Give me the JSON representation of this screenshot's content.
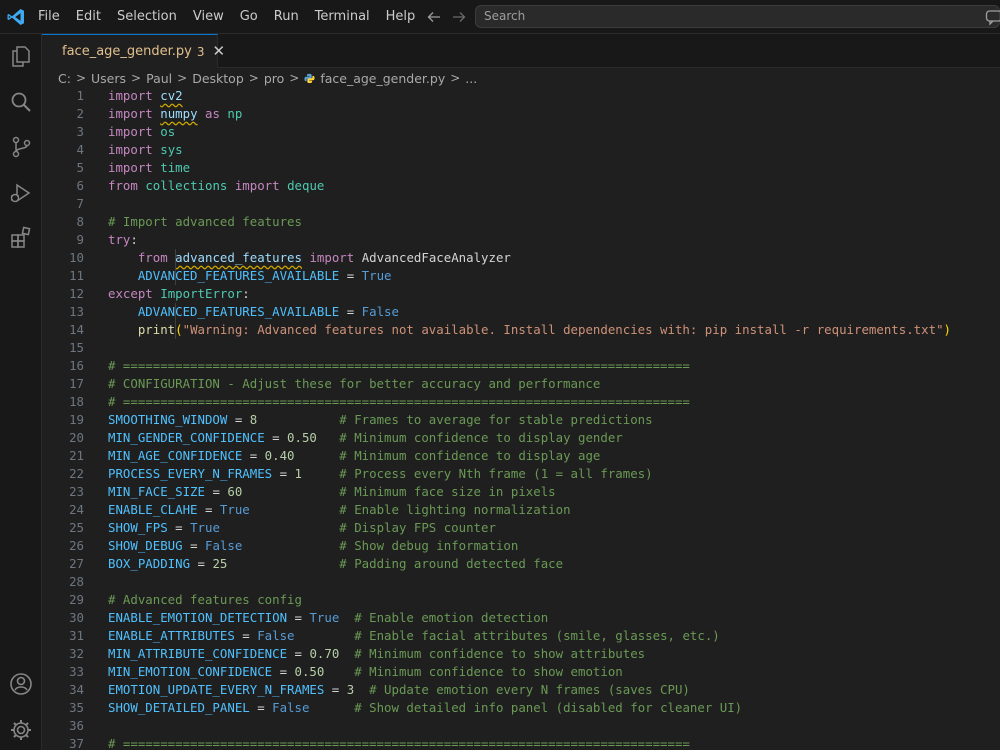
{
  "menu": [
    "File",
    "Edit",
    "Selection",
    "View",
    "Go",
    "Run",
    "Terminal",
    "Help"
  ],
  "search": {
    "placeholder": "Search"
  },
  "tab": {
    "name": "face_age_gender.py",
    "badge": "3",
    "close": "✕"
  },
  "breadcrumb": [
    "C:",
    "Users",
    "Paul",
    "Desktop",
    "pro",
    "face_age_gender.py",
    "..."
  ],
  "activity_icons": [
    "explorer-icon",
    "search-icon",
    "source-control-icon",
    "run-debug-icon",
    "extensions-icon",
    "accounts-icon",
    "settings-gear-icon"
  ],
  "colors": {
    "accent": "#0078d4",
    "editor_bg": "#1f1f1f",
    "sidebar_bg": "#181818",
    "modified_text": "#e2c08d"
  },
  "code": [
    {
      "n": "1",
      "t": [
        {
          "c": "kw",
          "v": "import"
        },
        {
          "c": "plain",
          "v": " "
        },
        {
          "c": "mod2 squig",
          "v": "cv2"
        }
      ]
    },
    {
      "n": "2",
      "t": [
        {
          "c": "kw",
          "v": "import"
        },
        {
          "c": "plain",
          "v": " "
        },
        {
          "c": "mod2 squig",
          "v": "numpy"
        },
        {
          "c": "plain",
          "v": " "
        },
        {
          "c": "kw",
          "v": "as"
        },
        {
          "c": "plain",
          "v": " "
        },
        {
          "c": "mod",
          "v": "np"
        }
      ]
    },
    {
      "n": "3",
      "t": [
        {
          "c": "kw",
          "v": "import"
        },
        {
          "c": "plain",
          "v": " "
        },
        {
          "c": "mod",
          "v": "os"
        }
      ]
    },
    {
      "n": "4",
      "t": [
        {
          "c": "kw",
          "v": "import"
        },
        {
          "c": "plain",
          "v": " "
        },
        {
          "c": "mod",
          "v": "sys"
        }
      ]
    },
    {
      "n": "5",
      "t": [
        {
          "c": "kw",
          "v": "import"
        },
        {
          "c": "plain",
          "v": " "
        },
        {
          "c": "mod",
          "v": "time"
        }
      ]
    },
    {
      "n": "6",
      "t": [
        {
          "c": "kw",
          "v": "from"
        },
        {
          "c": "plain",
          "v": " "
        },
        {
          "c": "mod",
          "v": "collections"
        },
        {
          "c": "plain",
          "v": " "
        },
        {
          "c": "kw",
          "v": "import"
        },
        {
          "c": "plain",
          "v": " "
        },
        {
          "c": "cls",
          "v": "deque"
        }
      ]
    },
    {
      "n": "7",
      "t": []
    },
    {
      "n": "8",
      "t": [
        {
          "c": "cmt",
          "v": "# Import advanced features"
        }
      ]
    },
    {
      "n": "9",
      "t": [
        {
          "c": "kw",
          "v": "try"
        },
        {
          "c": "plain",
          "v": ":"
        }
      ]
    },
    {
      "n": "10",
      "g": true,
      "t": [
        {
          "c": "plain",
          "v": "    "
        },
        {
          "c": "kw",
          "v": "from"
        },
        {
          "c": "plain",
          "v": " "
        },
        {
          "c": "mod2 squig",
          "v": "advanced_features"
        },
        {
          "c": "plain",
          "v": " "
        },
        {
          "c": "kw",
          "v": "import"
        },
        {
          "c": "plain",
          "v": " "
        },
        {
          "c": "plain",
          "v": "AdvancedFaceAnalyzer"
        }
      ]
    },
    {
      "n": "11",
      "g": true,
      "t": [
        {
          "c": "plain",
          "v": "    "
        },
        {
          "c": "var",
          "v": "ADVANCED_FEATURES_AVAILABLE"
        },
        {
          "c": "op",
          "v": " = "
        },
        {
          "c": "blue",
          "v": "True"
        }
      ]
    },
    {
      "n": "12",
      "t": [
        {
          "c": "kw",
          "v": "except"
        },
        {
          "c": "plain",
          "v": " "
        },
        {
          "c": "cls",
          "v": "ImportError"
        },
        {
          "c": "plain",
          "v": ":"
        }
      ]
    },
    {
      "n": "13",
      "g": true,
      "t": [
        {
          "c": "plain",
          "v": "    "
        },
        {
          "c": "var",
          "v": "ADVANCED_FEATURES_AVAILABLE"
        },
        {
          "c": "op",
          "v": " = "
        },
        {
          "c": "blue",
          "v": "False"
        }
      ]
    },
    {
      "n": "14",
      "g": true,
      "t": [
        {
          "c": "plain",
          "v": "    "
        },
        {
          "c": "fn",
          "v": "print"
        },
        {
          "c": "paren",
          "v": "("
        },
        {
          "c": "str",
          "v": "\"Warning: Advanced features not available. Install dependencies with: pip install -r requirements.txt\""
        },
        {
          "c": "paren",
          "v": ")"
        }
      ]
    },
    {
      "n": "15",
      "t": []
    },
    {
      "n": "16",
      "t": [
        {
          "c": "cmt",
          "v": "# ============================================================================"
        }
      ]
    },
    {
      "n": "17",
      "t": [
        {
          "c": "cmt",
          "v": "# CONFIGURATION - Adjust these for better accuracy and performance"
        }
      ]
    },
    {
      "n": "18",
      "t": [
        {
          "c": "cmt",
          "v": "# ============================================================================"
        }
      ]
    },
    {
      "n": "19",
      "t": [
        {
          "c": "var",
          "v": "SMOOTHING_WINDOW"
        },
        {
          "c": "op",
          "v": " = "
        },
        {
          "c": "num",
          "v": "8"
        },
        {
          "c": "plain",
          "v": "           "
        },
        {
          "c": "cmt",
          "v": "# Frames to average for stable predictions"
        }
      ]
    },
    {
      "n": "20",
      "t": [
        {
          "c": "var",
          "v": "MIN_GENDER_CONFIDENCE"
        },
        {
          "c": "op",
          "v": " = "
        },
        {
          "c": "num",
          "v": "0.50"
        },
        {
          "c": "plain",
          "v": "   "
        },
        {
          "c": "cmt",
          "v": "# Minimum confidence to display gender"
        }
      ]
    },
    {
      "n": "21",
      "t": [
        {
          "c": "var",
          "v": "MIN_AGE_CONFIDENCE"
        },
        {
          "c": "op",
          "v": " = "
        },
        {
          "c": "num",
          "v": "0.40"
        },
        {
          "c": "plain",
          "v": "      "
        },
        {
          "c": "cmt",
          "v": "# Minimum confidence to display age"
        }
      ]
    },
    {
      "n": "22",
      "t": [
        {
          "c": "var",
          "v": "PROCESS_EVERY_N_FRAMES"
        },
        {
          "c": "op",
          "v": " = "
        },
        {
          "c": "num",
          "v": "1"
        },
        {
          "c": "plain",
          "v": "     "
        },
        {
          "c": "cmt",
          "v": "# Process every Nth frame (1 = all frames)"
        }
      ]
    },
    {
      "n": "23",
      "t": [
        {
          "c": "var",
          "v": "MIN_FACE_SIZE"
        },
        {
          "c": "op",
          "v": " = "
        },
        {
          "c": "num",
          "v": "60"
        },
        {
          "c": "plain",
          "v": "             "
        },
        {
          "c": "cmt",
          "v": "# Minimum face size in pixels"
        }
      ]
    },
    {
      "n": "24",
      "t": [
        {
          "c": "var",
          "v": "ENABLE_CLAHE"
        },
        {
          "c": "op",
          "v": " = "
        },
        {
          "c": "blue",
          "v": "True"
        },
        {
          "c": "plain",
          "v": "            "
        },
        {
          "c": "cmt",
          "v": "# Enable lighting normalization"
        }
      ]
    },
    {
      "n": "25",
      "t": [
        {
          "c": "var",
          "v": "SHOW_FPS"
        },
        {
          "c": "op",
          "v": " = "
        },
        {
          "c": "blue",
          "v": "True"
        },
        {
          "c": "plain",
          "v": "                "
        },
        {
          "c": "cmt",
          "v": "# Display FPS counter"
        }
      ]
    },
    {
      "n": "26",
      "t": [
        {
          "c": "var",
          "v": "SHOW_DEBUG"
        },
        {
          "c": "op",
          "v": " = "
        },
        {
          "c": "blue",
          "v": "False"
        },
        {
          "c": "plain",
          "v": "             "
        },
        {
          "c": "cmt",
          "v": "# Show debug information"
        }
      ]
    },
    {
      "n": "27",
      "t": [
        {
          "c": "var",
          "v": "BOX_PADDING"
        },
        {
          "c": "op",
          "v": " = "
        },
        {
          "c": "num",
          "v": "25"
        },
        {
          "c": "plain",
          "v": "               "
        },
        {
          "c": "cmt",
          "v": "# Padding around detected face"
        }
      ]
    },
    {
      "n": "28",
      "t": []
    },
    {
      "n": "29",
      "t": [
        {
          "c": "cmt",
          "v": "# Advanced features config"
        }
      ]
    },
    {
      "n": "30",
      "t": [
        {
          "c": "var",
          "v": "ENABLE_EMOTION_DETECTION"
        },
        {
          "c": "op",
          "v": " = "
        },
        {
          "c": "blue",
          "v": "True"
        },
        {
          "c": "plain",
          "v": "  "
        },
        {
          "c": "cmt",
          "v": "# Enable emotion detection"
        }
      ]
    },
    {
      "n": "31",
      "t": [
        {
          "c": "var",
          "v": "ENABLE_ATTRIBUTES"
        },
        {
          "c": "op",
          "v": " = "
        },
        {
          "c": "blue",
          "v": "False"
        },
        {
          "c": "plain",
          "v": "        "
        },
        {
          "c": "cmt",
          "v": "# Enable facial attributes (smile, glasses, etc.)"
        }
      ]
    },
    {
      "n": "32",
      "t": [
        {
          "c": "var",
          "v": "MIN_ATTRIBUTE_CONFIDENCE"
        },
        {
          "c": "op",
          "v": " = "
        },
        {
          "c": "num",
          "v": "0.70"
        },
        {
          "c": "plain",
          "v": "  "
        },
        {
          "c": "cmt",
          "v": "# Minimum confidence to show attributes"
        }
      ]
    },
    {
      "n": "33",
      "t": [
        {
          "c": "var",
          "v": "MIN_EMOTION_CONFIDENCE"
        },
        {
          "c": "op",
          "v": " = "
        },
        {
          "c": "num",
          "v": "0.50"
        },
        {
          "c": "plain",
          "v": "    "
        },
        {
          "c": "cmt",
          "v": "# Minimum confidence to show emotion"
        }
      ]
    },
    {
      "n": "34",
      "t": [
        {
          "c": "var",
          "v": "EMOTION_UPDATE_EVERY_N_FRAMES"
        },
        {
          "c": "op",
          "v": " = "
        },
        {
          "c": "num",
          "v": "3"
        },
        {
          "c": "plain",
          "v": "  "
        },
        {
          "c": "cmt",
          "v": "# Update emotion every N frames (saves CPU)"
        }
      ]
    },
    {
      "n": "35",
      "t": [
        {
          "c": "var",
          "v": "SHOW_DETAILED_PANEL"
        },
        {
          "c": "op",
          "v": " = "
        },
        {
          "c": "blue",
          "v": "False"
        },
        {
          "c": "plain",
          "v": "      "
        },
        {
          "c": "cmt",
          "v": "# Show detailed info panel (disabled for cleaner UI)"
        }
      ]
    },
    {
      "n": "36",
      "t": []
    },
    {
      "n": "37",
      "t": [
        {
          "c": "cmt",
          "v": "# ============================================================================"
        }
      ]
    }
  ]
}
